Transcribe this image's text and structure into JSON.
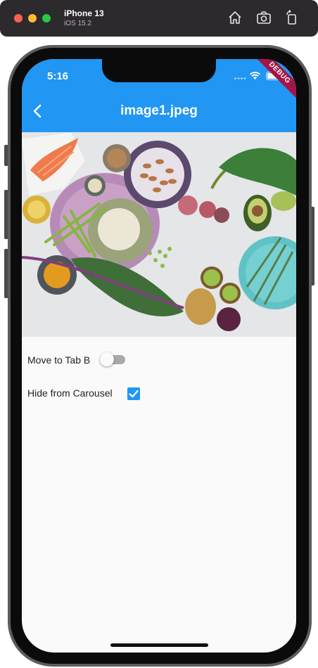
{
  "simulator": {
    "device_name": "iPhone 13",
    "os_version": "iOS 15.2",
    "toolbar_icons": [
      "home-icon",
      "camera-icon",
      "rotate-icon"
    ]
  },
  "status_bar": {
    "time": "5:16",
    "debug_banner": "DEBUG"
  },
  "app_bar": {
    "title": "image1.jpeg",
    "back_icon": "chevron-left-icon",
    "color": "#2196f3"
  },
  "image": {
    "description_icon": "food-photo"
  },
  "controls": {
    "move_to_tab": {
      "label": "Move to Tab B",
      "checked": false
    },
    "hide_from_carousel": {
      "label": "Hide from Carousel",
      "checked": true
    }
  }
}
